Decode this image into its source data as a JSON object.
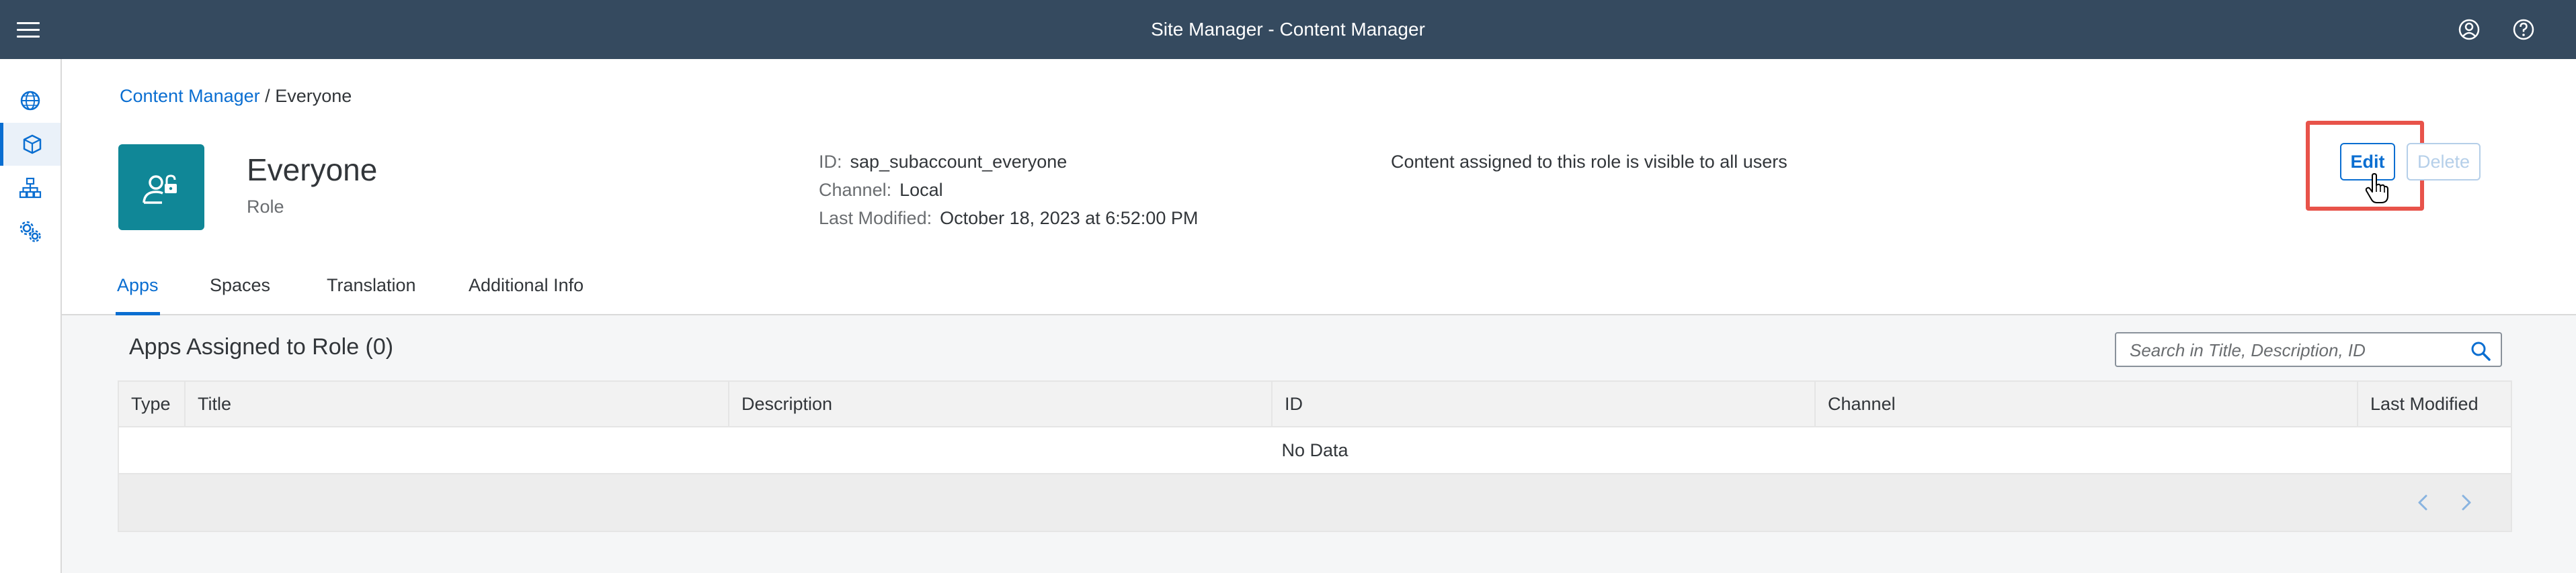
{
  "shell": {
    "title": "Site Manager - Content Manager",
    "icons": [
      "menu-icon",
      "user-icon",
      "help-icon"
    ]
  },
  "sidenav": {
    "items": [
      {
        "name": "globe-icon",
        "active": false
      },
      {
        "name": "cube-icon",
        "active": true
      },
      {
        "name": "hierarchy-icon",
        "active": false
      },
      {
        "name": "settings-icon",
        "active": false
      }
    ]
  },
  "breadcrumb": {
    "link": "Content Manager",
    "separator": "/",
    "current": "Everyone"
  },
  "object": {
    "title": "Everyone",
    "subtitle": "Role",
    "avatar_icon": "user-lock-icon",
    "attributes": [
      {
        "label": "ID:",
        "value": "sap_subaccount_everyone"
      },
      {
        "label": "Channel:",
        "value": "Local"
      },
      {
        "label": "Last Modified:",
        "value": "October 18, 2023 at 6:52:00 PM"
      }
    ],
    "description": "Content assigned to this role is visible to all users"
  },
  "actions": {
    "edit": "Edit",
    "delete": "Delete"
  },
  "tabs": [
    {
      "label": "Apps",
      "active": true
    },
    {
      "label": "Spaces",
      "active": false
    },
    {
      "label": "Translation",
      "active": false
    },
    {
      "label": "Additional Info",
      "active": false
    }
  ],
  "table": {
    "title": "Apps Assigned to Role (0)",
    "search_placeholder": "Search in Title, Description, ID",
    "columns": [
      "Type",
      "Title",
      "Description",
      "ID",
      "Channel",
      "Last Modified"
    ],
    "empty_text": "No Data"
  },
  "colors": {
    "shell": "#354a5f",
    "accent": "#0a6ed1",
    "avatar": "#108797",
    "highlight": "#e8534a"
  }
}
